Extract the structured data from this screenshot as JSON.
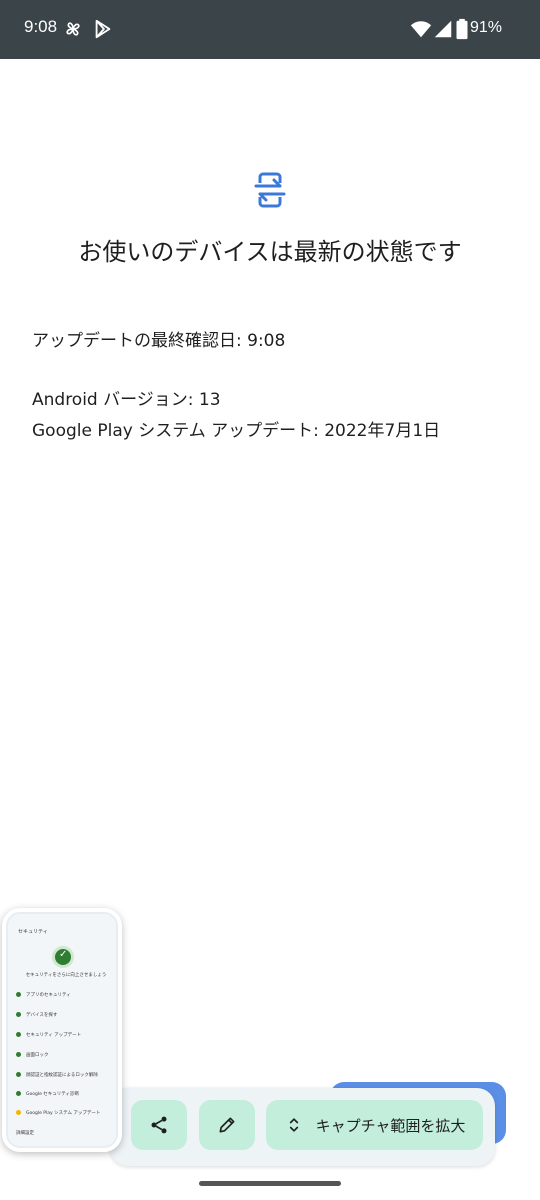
{
  "status_bar": {
    "time": "9:08",
    "battery_text": "91%",
    "icons": [
      "pinwheel-icon",
      "play-store-icon",
      "wifi-icon",
      "signal-icon",
      "battery-icon"
    ]
  },
  "main": {
    "heading": "お使いのデバイスは最新の状態です",
    "last_check": "アップデートの最終確認日: 9:08",
    "android_version": "Android バージョン: 13",
    "gplay_update": "Google Play システム アップデート: 2022年7月1日",
    "icon": "system-update-icon",
    "accent_color": "#3c78d8"
  },
  "screenshot_preview": {
    "title": "セキュリティ",
    "subtitle": "セキュリティをさらに向上させましょう",
    "rows": [
      {
        "label": "アプリのセキュリティ",
        "status": "ok"
      },
      {
        "label": "デバイスを探す",
        "status": "ok"
      },
      {
        "label": "セキュリティ アップデート",
        "status": "ok"
      },
      {
        "label": "画面ロック",
        "status": "ok"
      },
      {
        "label": "顔認証と指紋認証によるロック解除",
        "status": "ok"
      },
      {
        "label": "Google セキュリティ診断",
        "status": "ok"
      },
      {
        "label": "Google Play システム アップデート",
        "status": "warn"
      },
      {
        "label": "詳細設定",
        "status": "none"
      }
    ]
  },
  "actions": {
    "share_icon": "share-icon",
    "edit_icon": "pencil-icon",
    "expand_label": "キャプチャ範囲を拡大",
    "expand_icon": "expand-vertical-icon"
  }
}
